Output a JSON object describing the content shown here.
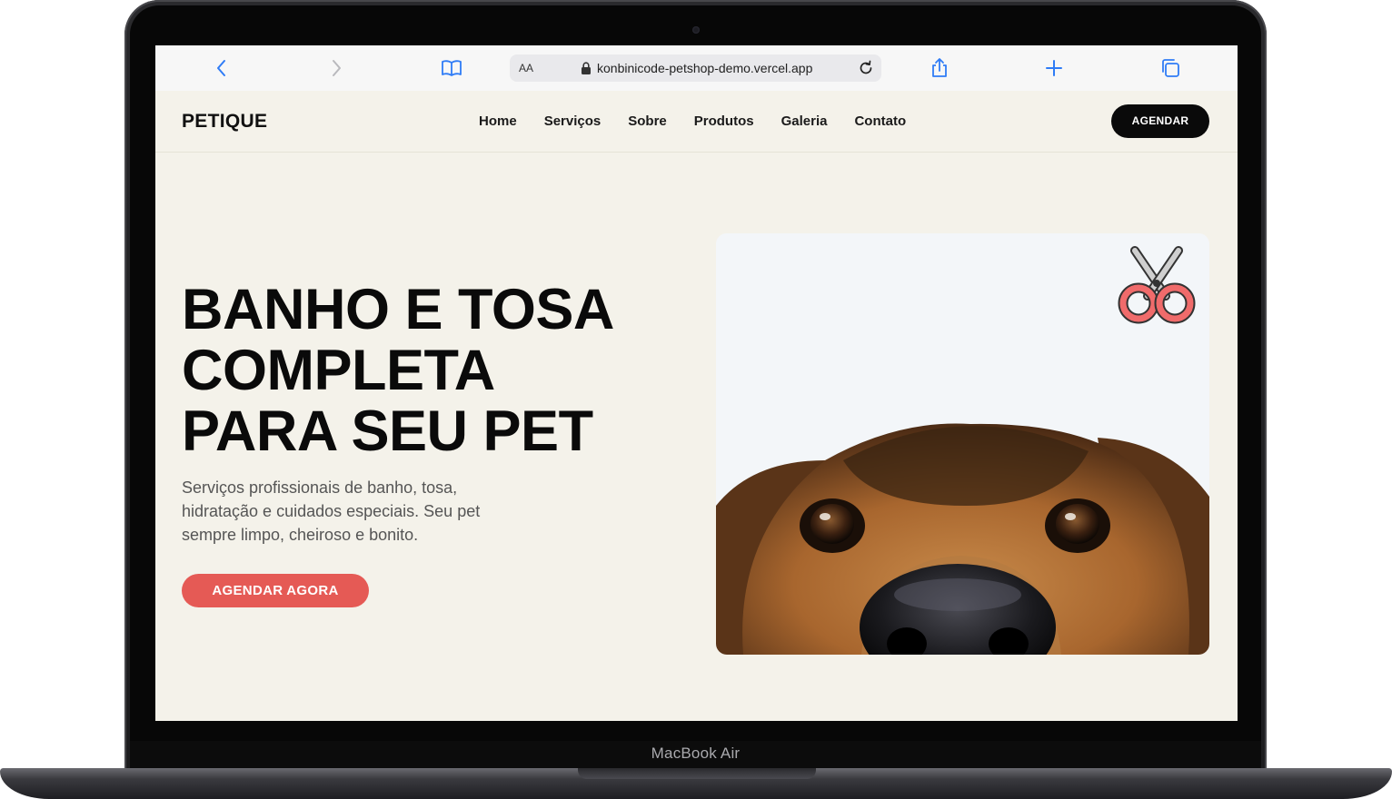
{
  "device": {
    "label": "MacBook Air"
  },
  "browser": {
    "text_size_label": "AA",
    "url": "konbinicode-petshop-demo.vercel.app"
  },
  "site": {
    "logo": "PETIQUE",
    "nav": [
      "Home",
      "Serviços",
      "Sobre",
      "Produtos",
      "Galeria",
      "Contato"
    ],
    "header_button": "AGENDAR"
  },
  "hero": {
    "title_lines": [
      "BANHO E TOSA",
      "COMPLETA",
      "PARA SEU PET"
    ],
    "description": "Serviços profissionais de banho, tosa, hidratação e cuidados especiais. Seu pet sempre limpo, cheiroso e bonito.",
    "cta": "AGENDAR AGORA"
  },
  "colors": {
    "page_bg": "#f4f2ea",
    "accent": "#e55a55",
    "dark": "#0a0a0a"
  }
}
